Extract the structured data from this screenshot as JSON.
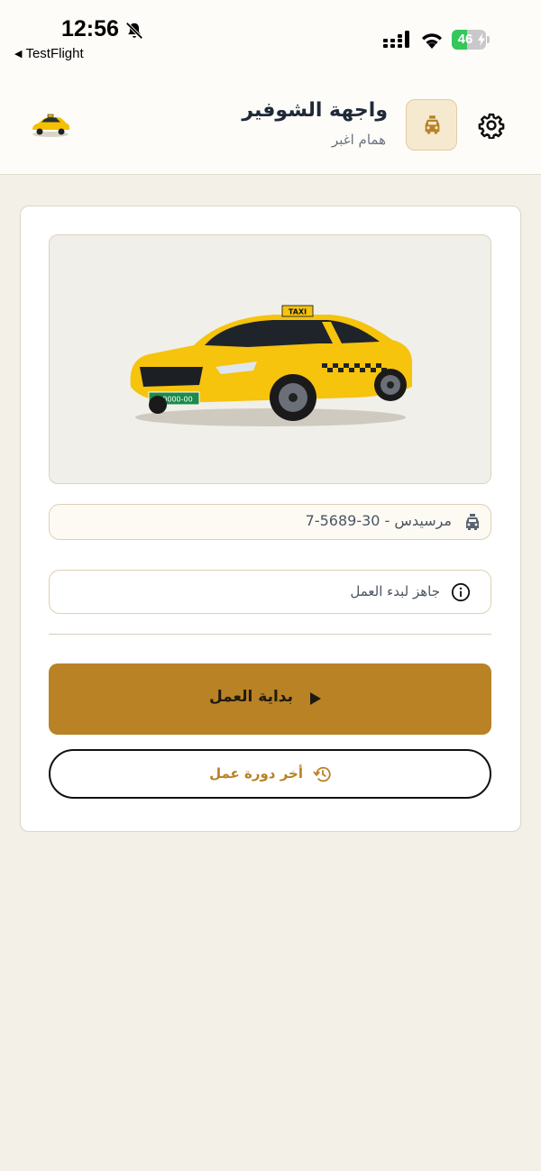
{
  "status_bar": {
    "time": "12:56",
    "back_app": "TestFlight",
    "battery_percent": "46",
    "battery_level": 0.46
  },
  "header": {
    "title": "واجهة الشوفير",
    "subtitle": "همام اغبر"
  },
  "vehicle": {
    "label": "مرسيدس - 30-5689-7"
  },
  "status": {
    "message": "جاهز لبدء العمل"
  },
  "actions": {
    "start_label": "بداية العمل",
    "last_shift_label": "أخر دورة عمل"
  },
  "car_image": {
    "roof_sign": "TAXI",
    "plate": "7-0000-00"
  },
  "colors": {
    "accent": "#b88225",
    "background": "#f3f0e8",
    "battery": "#34c759"
  },
  "icons": [
    "bell-slash-icon",
    "signal-icon",
    "wifi-icon",
    "battery-icon",
    "taxi-icon",
    "gear-icon",
    "info-icon",
    "play-icon",
    "history-icon"
  ]
}
